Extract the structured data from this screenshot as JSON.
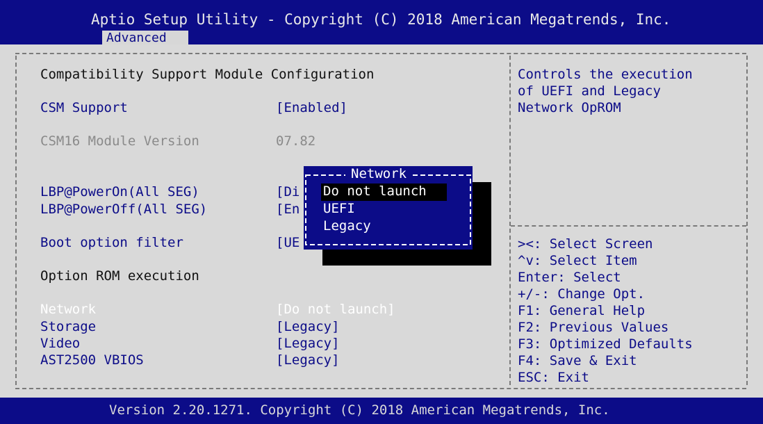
{
  "header": {
    "title": "Aptio Setup Utility - Copyright (C) 2018 American Megatrends, Inc.",
    "active_tab": "Advanced"
  },
  "section_title": "Compatibility Support Module Configuration",
  "settings": [
    {
      "label": "CSM Support",
      "value": "[Enabled]"
    },
    {
      "label": "CSM16 Module Version",
      "value": "07.82"
    },
    {
      "label": "LBP@PowerOn(All SEG)",
      "value": "[Di"
    },
    {
      "label": "LBP@PowerOff(All SEG)",
      "value": "[En"
    },
    {
      "label": "Boot option filter",
      "value": "[UE"
    },
    {
      "label": "Option ROM execution"
    },
    {
      "label": "Network",
      "value": "[Do not launch]"
    },
    {
      "label": "Storage",
      "value": "[Legacy]"
    },
    {
      "label": "Video",
      "value": "[Legacy]"
    },
    {
      "label": "AST2500 VBIOS",
      "value": "[Legacy]"
    }
  ],
  "help": {
    "description": [
      "Controls the execution",
      "of UEFI and Legacy",
      "Network OpROM"
    ],
    "keys": [
      "><: Select Screen",
      "^v: Select Item",
      "Enter: Select",
      "+/-: Change Opt.",
      "F1: General Help",
      "F2: Previous Values",
      "F3: Optimized Defaults",
      "F4: Save & Exit",
      "ESC: Exit"
    ]
  },
  "popup": {
    "title": "Network",
    "options": [
      "Do not launch",
      "UEFI",
      "Legacy"
    ],
    "selected": "Do not launch"
  },
  "footer": {
    "text": "Version 2.20.1271. Copyright (C) 2018 American Megatrends, Inc."
  }
}
